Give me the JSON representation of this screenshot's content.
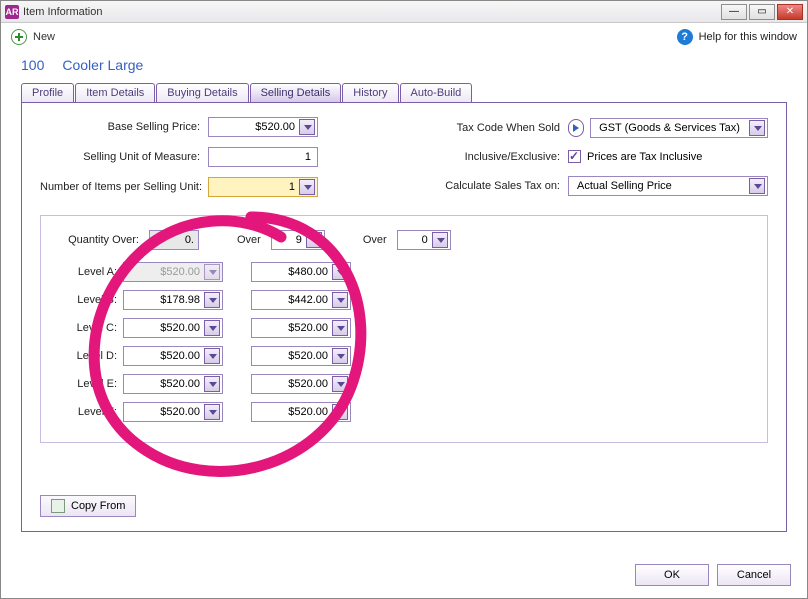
{
  "window": {
    "title": "Item Information"
  },
  "toolbar": {
    "new_label": "New",
    "help_label": "Help for this window"
  },
  "item": {
    "code": "100",
    "name": "Cooler Large"
  },
  "tabs": {
    "profile": "Profile",
    "item_details": "Item Details",
    "buying_details": "Buying Details",
    "selling_details": "Selling Details",
    "history": "History",
    "auto_build": "Auto-Build"
  },
  "selling": {
    "base_selling_price_label": "Base Selling Price:",
    "base_selling_price": "$520.00",
    "selling_uom_label": "Selling Unit of Measure:",
    "selling_uom": "1",
    "items_per_unit_label": "Number of Items per Selling Unit:",
    "items_per_unit": "1",
    "tax_code_label": "Tax Code When Sold",
    "tax_code": "GST (Goods & Services Tax)",
    "incl_excl_label": "Inclusive/Exclusive:",
    "incl_checkbox_label": "Prices are Tax Inclusive",
    "incl_checked": true,
    "calc_label": "Calculate Sales Tax on:",
    "calc_value": "Actual Selling Price"
  },
  "pricing": {
    "quantity_over_label": "Quantity Over:",
    "qty1": "0.",
    "over_label": "Over",
    "qty2": "9",
    "qty3": "0",
    "levels": {
      "A": {
        "label": "Level A:",
        "c1": "$520.00",
        "c2": "$480.00"
      },
      "B": {
        "label": "Level B:",
        "c1": "$178.98",
        "c2": "$442.00"
      },
      "C": {
        "label": "Level C:",
        "c1": "$520.00",
        "c2": "$520.00"
      },
      "D": {
        "label": "Level D:",
        "c1": "$520.00",
        "c2": "$520.00"
      },
      "E": {
        "label": "Level E:",
        "c1": "$520.00",
        "c2": "$520.00"
      },
      "F": {
        "label": "Level F:",
        "c1": "$520.00",
        "c2": "$520.00"
      }
    }
  },
  "actions": {
    "copy_from": "Copy From",
    "ok": "OK",
    "cancel": "Cancel"
  }
}
